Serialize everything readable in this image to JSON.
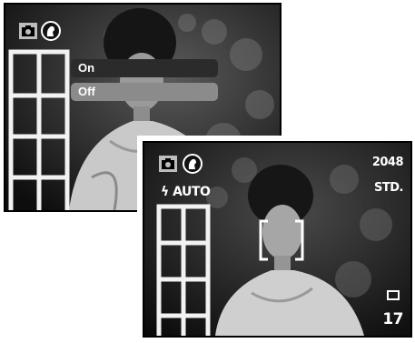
{
  "back_screen": {
    "menu": {
      "items": [
        {
          "label": "On",
          "selected": false
        },
        {
          "label": "Off",
          "selected": true
        }
      ]
    },
    "icons": [
      "camera-mode-icon",
      "face-detection-icon"
    ]
  },
  "front_screen": {
    "flash_mode": "AUTO",
    "image_size": "2048",
    "quality": "STD.",
    "frames_remaining": "17",
    "icons": [
      "camera-mode-icon",
      "face-detection-icon",
      "flash-icon",
      "single-frame-icon",
      "focus-frame-icon"
    ]
  }
}
